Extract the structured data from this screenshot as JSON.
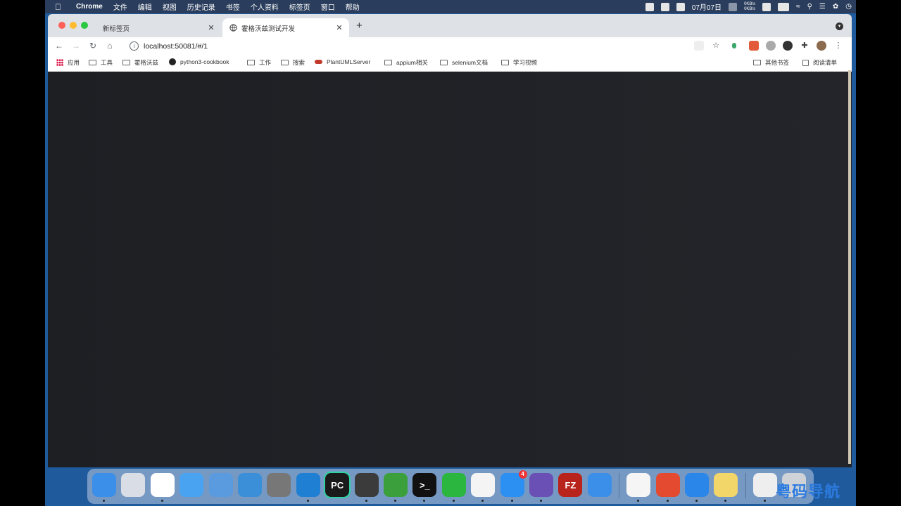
{
  "menubar": {
    "app_name": "Chrome",
    "items": [
      "文件",
      "编辑",
      "视图",
      "历史记录",
      "书签",
      "个人资料",
      "标签页",
      "窗口",
      "帮助"
    ],
    "date": "07月07日",
    "net_up": "0KB/s",
    "net_down": "0KB/s"
  },
  "browser": {
    "tabs": [
      {
        "label": "新标签页",
        "active": false
      },
      {
        "label": "霍格沃兹测试开发",
        "active": true
      }
    ],
    "new_tab_label": "+",
    "url": "localhost:50081/#/1",
    "bookmarks": [
      {
        "label": "应用",
        "icon": "apps-grid-icon"
      },
      {
        "label": "工具",
        "icon": "folder-icon"
      },
      {
        "label": "霍格沃兹",
        "icon": "folder-icon"
      },
      {
        "label": "python3-cookbook",
        "icon": "github-icon"
      },
      {
        "label": "工作",
        "icon": "folder-icon"
      },
      {
        "label": "搜索",
        "icon": "folder-icon"
      },
      {
        "label": "PlantUMLServer",
        "icon": "plantuml-icon"
      },
      {
        "label": "appium相关",
        "icon": "folder-icon"
      },
      {
        "label": "selenium文档",
        "icon": "folder-icon"
      },
      {
        "label": "学习视频",
        "icon": "folder-icon"
      }
    ],
    "other_bookmarks": "其他书签",
    "reading_list": "阅读清单"
  },
  "dock": {
    "apps": [
      {
        "name": "finder-icon",
        "color": "#3c8fe8"
      },
      {
        "name": "launchpad-icon",
        "color": "#d9dde6"
      },
      {
        "name": "chrome-icon",
        "color": "#ffffff"
      },
      {
        "name": "safari-icon",
        "color": "#4aa3f0"
      },
      {
        "name": "keynote-icon",
        "color": "#5a9be0"
      },
      {
        "name": "tableau-icon",
        "color": "#3b8fd9"
      },
      {
        "name": "system-preferences-icon",
        "color": "#777"
      },
      {
        "name": "vscode-icon",
        "color": "#1f7fd2"
      },
      {
        "name": "pycharm-icon",
        "color": "#1a1a1a"
      },
      {
        "name": "sublime-text-icon",
        "color": "#3b3b3b"
      },
      {
        "name": "evernote-icon",
        "color": "#3ba03b"
      },
      {
        "name": "terminal-icon",
        "color": "#111"
      },
      {
        "name": "wechat-icon",
        "color": "#2bb640"
      },
      {
        "name": "qq-icon",
        "color": "#f4f4f4"
      },
      {
        "name": "app-store-icon",
        "color": "#2c8ff2"
      },
      {
        "name": "screen-recorder-icon",
        "color": "#6a4fb5"
      },
      {
        "name": "filezilla-icon",
        "color": "#b8231c"
      },
      {
        "name": "feishu-icon",
        "color": "#3c8fe8"
      },
      {
        "name": "wps-icon",
        "color": "#f5f5f5"
      },
      {
        "name": "xmind-icon",
        "color": "#e34a2f"
      },
      {
        "name": "lanhu-icon",
        "color": "#2a86e8"
      },
      {
        "name": "notes-icon",
        "color": "#f2d66a"
      },
      {
        "name": "preview-icon",
        "color": "#eeeeee"
      },
      {
        "name": "trash-icon",
        "color": "#cfd3d8"
      }
    ],
    "app_store_badge": "4",
    "glyphs": {
      "pycharm": "PC",
      "filezilla": "FZ",
      "terminal": ">_"
    }
  },
  "watermark": "粤码导航网"
}
